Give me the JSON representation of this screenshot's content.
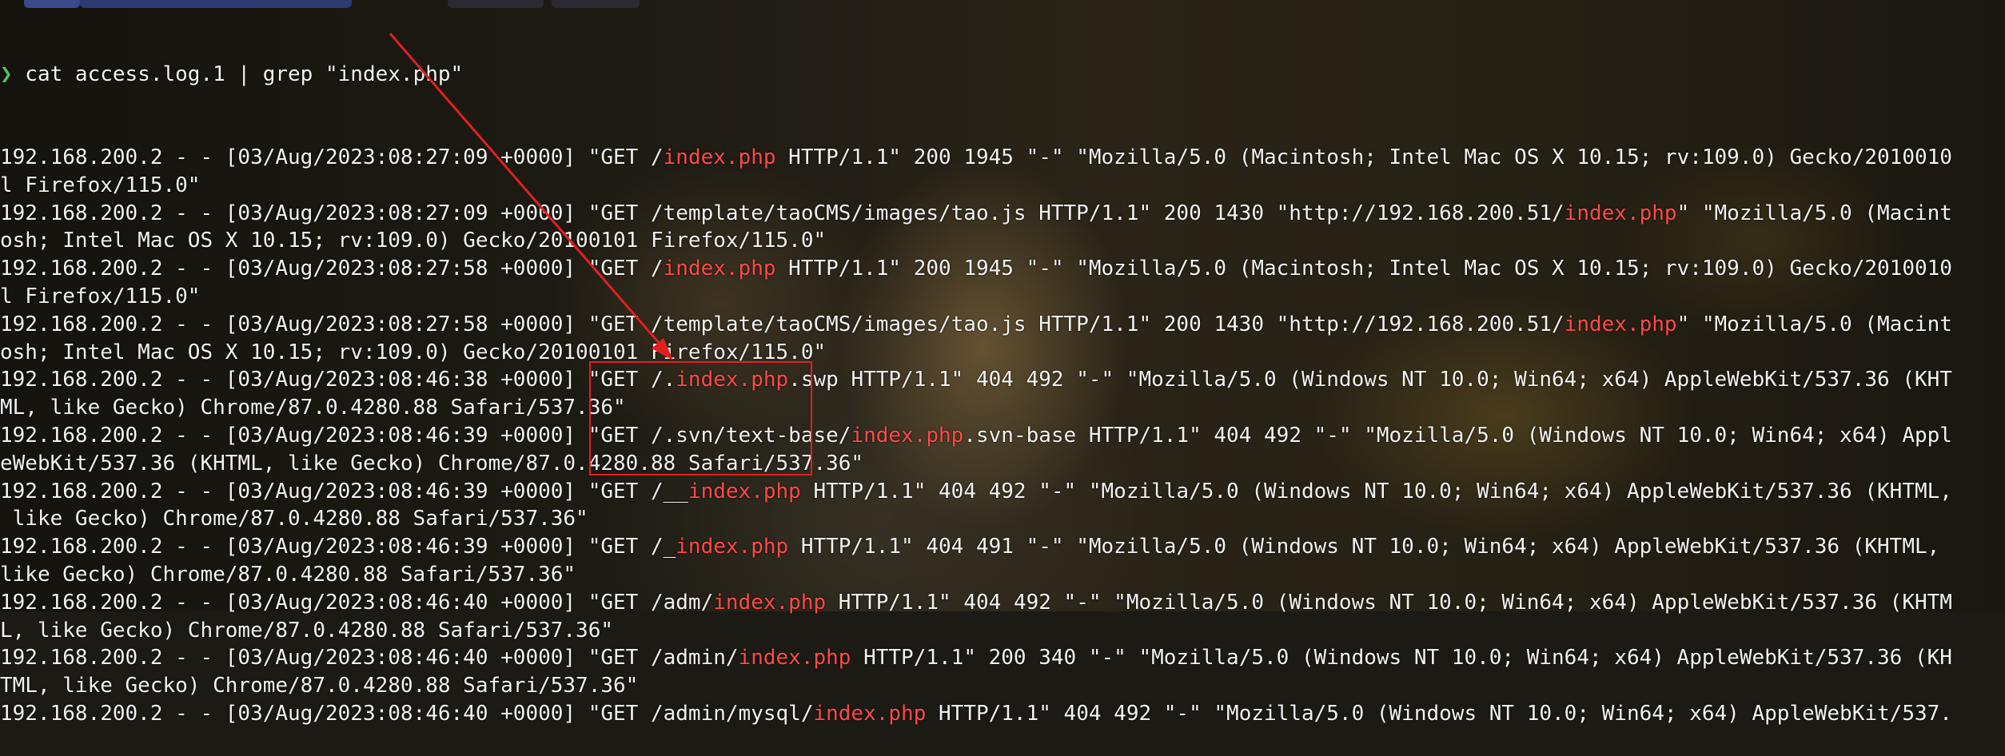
{
  "prompt": {
    "arrow": "❯",
    "command": " cat access.log.1 | grep \"index.php\""
  },
  "highlight_term": "index.php",
  "colors": {
    "highlight": "#ff4a4a",
    "annotation": "#e02020",
    "prompt_arrow": "#57c25a",
    "text": "#f2f2f2"
  },
  "lines": [
    "192.168.200.2 - - [03/Aug/2023:08:27:09 +0000] \"GET /index.php HTTP/1.1\" 200 1945 \"-\" \"Mozilla/5.0 (Macintosh; Intel Mac OS X 10.15; rv:109.0) Gecko/2010010",
    "l Firefox/115.0\"",
    "192.168.200.2 - - [03/Aug/2023:08:27:09 +0000] \"GET /template/taoCMS/images/tao.js HTTP/1.1\" 200 1430 \"http://192.168.200.51/index.php\" \"Mozilla/5.0 (Macint",
    "osh; Intel Mac OS X 10.15; rv:109.0) Gecko/20100101 Firefox/115.0\"",
    "192.168.200.2 - - [03/Aug/2023:08:27:58 +0000] \"GET /index.php HTTP/1.1\" 200 1945 \"-\" \"Mozilla/5.0 (Macintosh; Intel Mac OS X 10.15; rv:109.0) Gecko/2010010",
    "l Firefox/115.0\"",
    "192.168.200.2 - - [03/Aug/2023:08:27:58 +0000] \"GET /template/taoCMS/images/tao.js HTTP/1.1\" 200 1430 \"http://192.168.200.51/index.php\" \"Mozilla/5.0 (Macint",
    "osh; Intel Mac OS X 10.15; rv:109.0) Gecko/20100101 Firefox/115.0\"",
    "192.168.200.2 - - [03/Aug/2023:08:46:38 +0000] \"GET /.index.php.swp HTTP/1.1\" 404 492 \"-\" \"Mozilla/5.0 (Windows NT 10.0; Win64; x64) AppleWebKit/537.36 (KHT",
    "ML, like Gecko) Chrome/87.0.4280.88 Safari/537.36\"",
    "192.168.200.2 - - [03/Aug/2023:08:46:39 +0000] \"GET /.svn/text-base/index.php.svn-base HTTP/1.1\" 404 492 \"-\" \"Mozilla/5.0 (Windows NT 10.0; Win64; x64) Appl",
    "eWebKit/537.36 (KHTML, like Gecko) Chrome/87.0.4280.88 Safari/537.36\"",
    "192.168.200.2 - - [03/Aug/2023:08:46:39 +0000] \"GET /__index.php HTTP/1.1\" 404 492 \"-\" \"Mozilla/5.0 (Windows NT 10.0; Win64; x64) AppleWebKit/537.36 (KHTML,",
    " like Gecko) Chrome/87.0.4280.88 Safari/537.36\"",
    "192.168.200.2 - - [03/Aug/2023:08:46:39 +0000] \"GET /_index.php HTTP/1.1\" 404 491 \"-\" \"Mozilla/5.0 (Windows NT 10.0; Win64; x64) AppleWebKit/537.36 (KHTML,",
    "like Gecko) Chrome/87.0.4280.88 Safari/537.36\"",
    "192.168.200.2 - - [03/Aug/2023:08:46:40 +0000] \"GET /adm/index.php HTTP/1.1\" 404 492 \"-\" \"Mozilla/5.0 (Windows NT 10.0; Win64; x64) AppleWebKit/537.36 (KHTM",
    "L, like Gecko) Chrome/87.0.4280.88 Safari/537.36\"",
    "192.168.200.2 - - [03/Aug/2023:08:46:40 +0000] \"GET /admin/index.php HTTP/1.1\" 200 340 \"-\" \"Mozilla/5.0 (Windows NT 10.0; Win64; x64) AppleWebKit/537.36 (KH",
    "TML, like Gecko) Chrome/87.0.4280.88 Safari/537.36\"",
    "192.168.200.2 - - [03/Aug/2023:08:46:40 +0000] \"GET /admin/mysql/index.php HTTP/1.1\" 404 492 \"-\" \"Mozilla/5.0 (Windows NT 10.0; Win64; x64) AppleWebKit/537."
  ]
}
